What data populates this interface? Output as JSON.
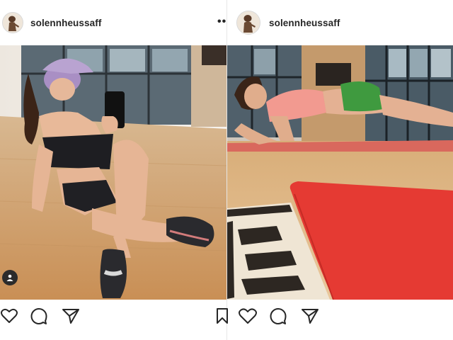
{
  "posts": [
    {
      "username": "solennheussaff",
      "avatar_icon": "profile-avatar",
      "tag_icon": "user-tag-icon",
      "actions": [
        "heart-icon",
        "comment-icon",
        "share-icon"
      ]
    },
    {
      "username": "solennheussaff",
      "avatar_icon": "profile-avatar",
      "more_label": "••",
      "actions": [
        "bookmark-icon",
        "heart-icon",
        "comment-icon",
        "share-icon"
      ]
    }
  ],
  "colors": {
    "text": "#262626",
    "floor_wood": "#d9ae7a",
    "mat_red": "#e0322f",
    "top_pink": "#f0968e",
    "shorts_green": "#3a8f3c"
  }
}
